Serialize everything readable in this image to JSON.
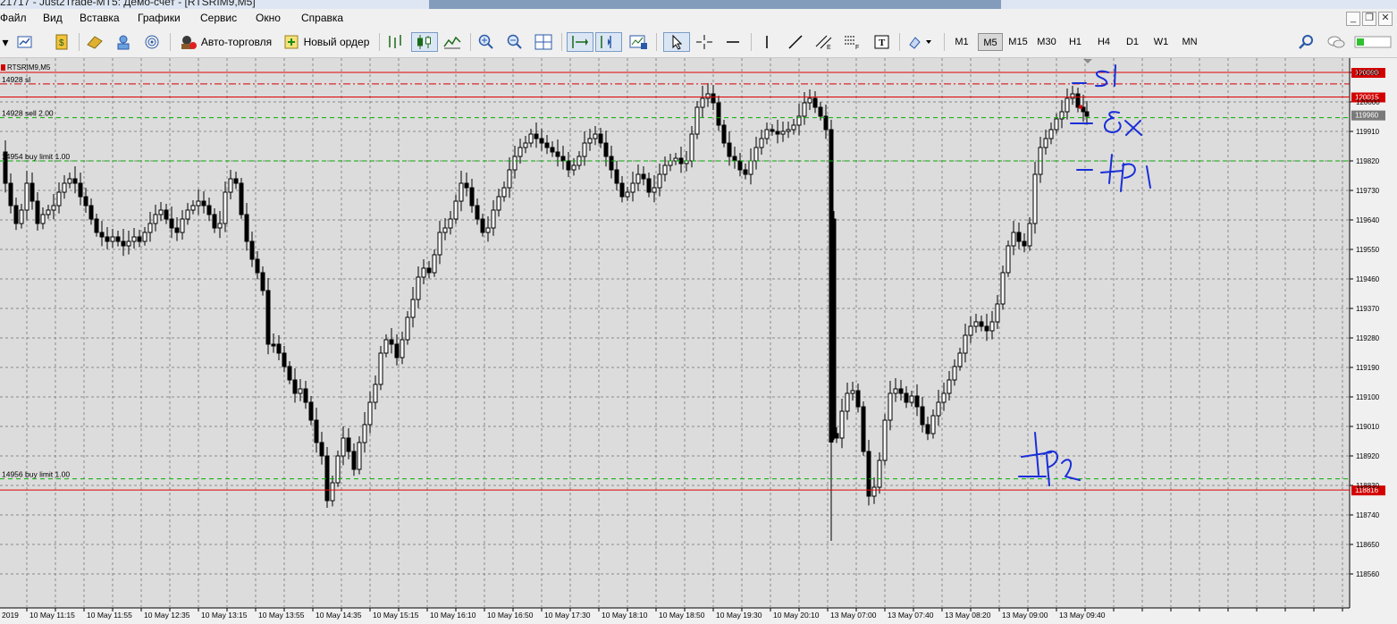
{
  "window": {
    "title": "21717 - Just2Trade-MT5: Демо-счет - [RTSRIM9,M5]"
  },
  "menu": [
    "Файл",
    "Вид",
    "Вставка",
    "Графики",
    "Сервис",
    "Окно",
    "Справка"
  ],
  "toolbar": {
    "autotrading_label": "Авто-торговля",
    "new_order_label": "Новый ордер",
    "timeframes": [
      "M1",
      "M5",
      "M15",
      "M30",
      "H1",
      "H4",
      "D1",
      "W1",
      "MN"
    ],
    "selected_timeframe": "M5"
  },
  "chart": {
    "symbol_label": "RTSRIM9,M5",
    "price_labels": [
      "120090",
      "120000",
      "119910",
      "119820",
      "119730",
      "119640",
      "119550",
      "119460",
      "119370",
      "119280",
      "119190",
      "119100",
      "119010",
      "118920",
      "118830",
      "118740",
      "118650",
      "118560"
    ],
    "current_price": "119960",
    "time_labels": [
      "2019",
      "10 May 11:15",
      "10 May 11:55",
      "10 May 12:35",
      "10 May 13:15",
      "10 May 13:55",
      "10 May 14:35",
      "10 May 15:15",
      "10 May 16:10",
      "10 May 16:50",
      "10 May 17:30",
      "10 May 18:10",
      "10 May 18:50",
      "10 May 19:30",
      "10 May 20:10",
      "13 May 07:00",
      "13 May 07:40",
      "13 May 08:20",
      "13 May 09:00",
      "13 May 09:40"
    ],
    "order_lines": [
      {
        "label": "14928 sl",
        "price": 120055,
        "color": "#d40000",
        "style": "dashdot"
      },
      {
        "label": "14928 sell 2.00",
        "price": 119952,
        "color": "#00b000",
        "style": "dash"
      },
      {
        "label": "14954 buy limit 1.00",
        "price": 119820,
        "color": "#00b000",
        "style": "dash"
      },
      {
        "label": "14956 buy limit 1.00",
        "price": 118850,
        "color": "#00b000",
        "style": "dash"
      }
    ],
    "level_lines": [
      {
        "price_label": "120090",
        "price": 120090
      },
      {
        "price_label": "120015",
        "price": 120015
      },
      {
        "price_label": "118816",
        "price": 118816
      }
    ],
    "annotations": [
      "sl",
      "вх",
      "tp1",
      "tp2"
    ]
  },
  "colors": {
    "chart_bg": "#dcdcdc",
    "grid": "#8a8a8a",
    "level_red": "#e00000",
    "order_green": "#00b000",
    "annotation_blue": "#1a2ed8"
  }
}
